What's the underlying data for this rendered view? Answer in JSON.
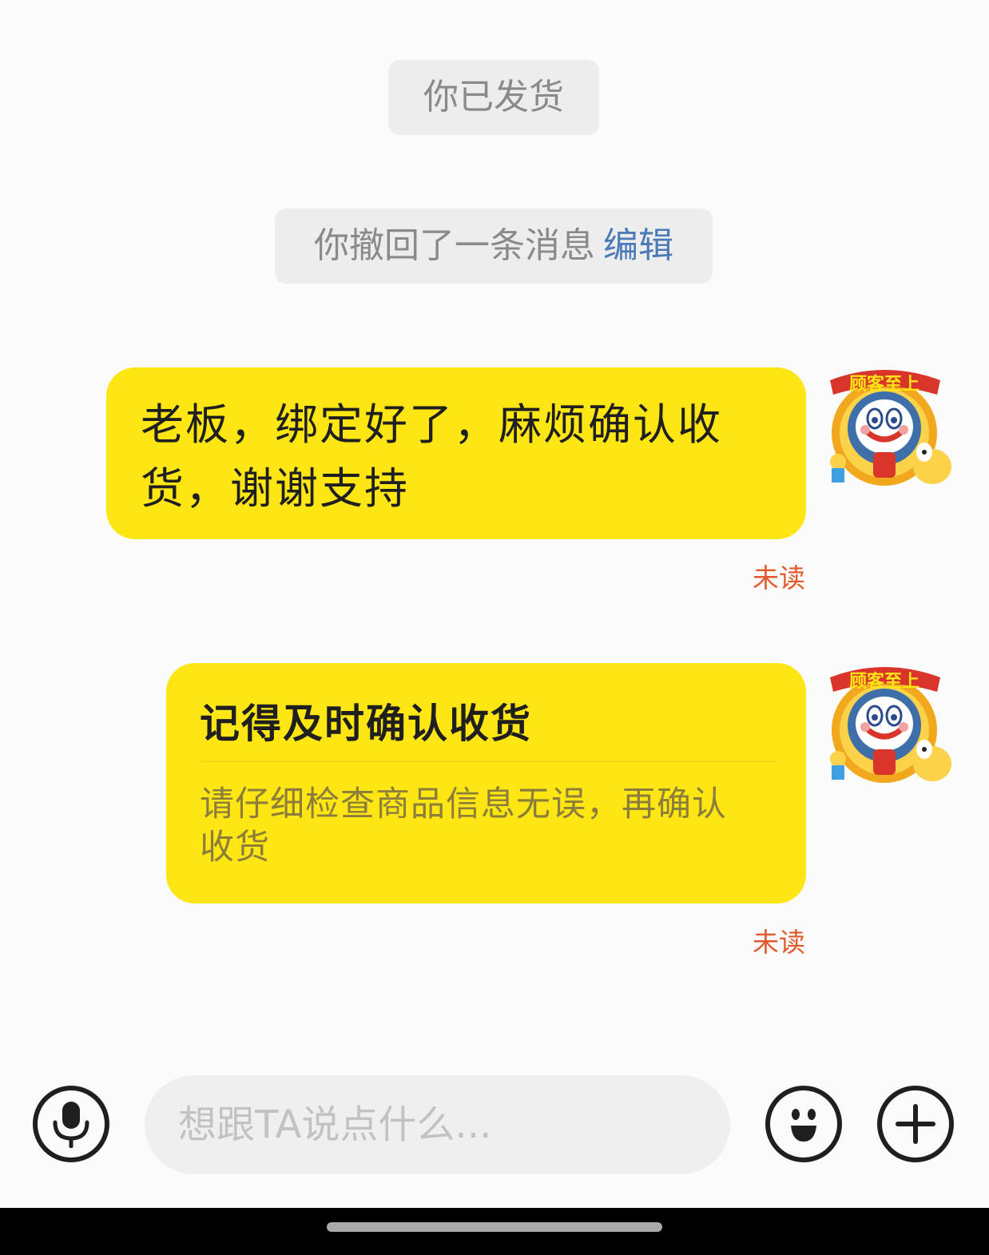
{
  "system_messages": [
    {
      "text": "你已发货"
    },
    {
      "text": "你撤回了一条消息",
      "action": "编辑"
    }
  ],
  "messages": [
    {
      "text_line1": "老板，绑定好了，麻烦确认收",
      "text_line2": "货，谢谢支持",
      "status": "未读"
    },
    {
      "title": "记得及时确认收货",
      "body": "请仔细检查商品信息无误，再确认收货",
      "status": "未读"
    }
  ],
  "avatar": {
    "badge_text": "顾客至上",
    "icon": "clown-mascot-avatar"
  },
  "input_bar": {
    "placeholder": "想跟TA说点什么...",
    "mic_icon": "microphone-icon",
    "emoji_icon": "smiley-face-icon",
    "plus_icon": "plus-icon"
  },
  "colors": {
    "bubble": "#fde614",
    "unread": "#e25a2c",
    "link": "#4a7ab8",
    "system_pill": "#ededed"
  }
}
